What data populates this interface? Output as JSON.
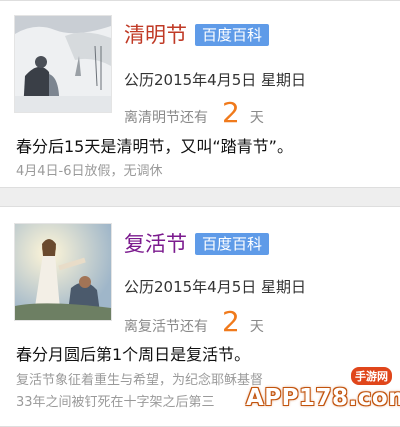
{
  "cards": [
    {
      "title": "清明节",
      "badge": "百度百科",
      "date": "公历2015年4月5日 星期日",
      "countdown_prefix": "离清明节还有",
      "countdown_number": "2",
      "countdown_suffix": "天",
      "description": "春分后15天是清明节，又叫“踏青节”。",
      "note": "4月4日-6日放假，无调休",
      "image_icon": "qingming-painting-image"
    },
    {
      "title": "复活节",
      "badge": "百度百科",
      "date": "公历2015年4月5日 星期日",
      "countdown_prefix": "离复活节还有",
      "countdown_number": "2",
      "countdown_suffix": "天",
      "description": "春分月圆后第1个周日是复活节。",
      "note_line1": "复活节象征着重生与希望，为纪念耶稣基督",
      "note_line2": "33年之间被钉死在十字架之后第三",
      "image_icon": "easter-jesus-painting-image"
    }
  ],
  "watermark": {
    "text": "APP178.com",
    "sub": "手游网"
  },
  "colors": {
    "title1": "#c03a26",
    "title2": "#7b1a8e",
    "badge": "#5f9be8",
    "countdown_number": "#f07a1c"
  }
}
